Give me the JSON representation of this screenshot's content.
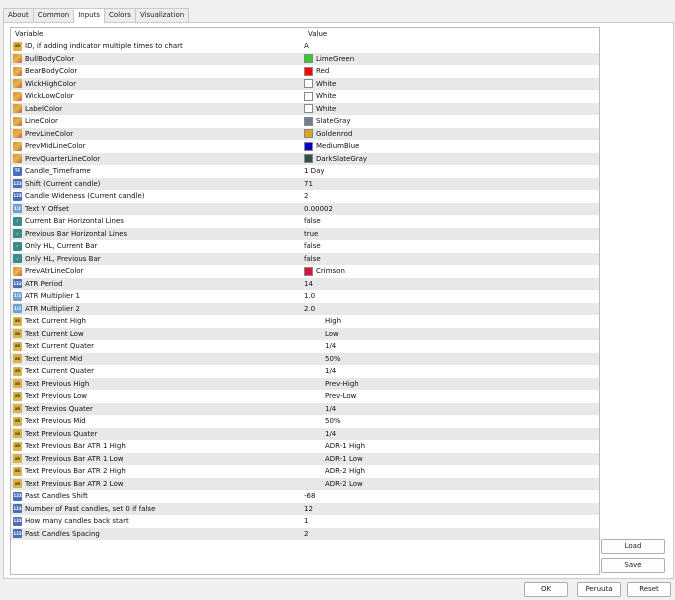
{
  "tabs": [
    "About",
    "Common",
    "Inputs",
    "Colors",
    "Visualization"
  ],
  "columns": {
    "variable": "Variable",
    "value": "Value"
  },
  "rows": [
    {
      "icon": "string",
      "name": "ID, if adding indicator multiple times to chart",
      "value": "A"
    },
    {
      "icon": "color",
      "name": "BullBodyColor",
      "value": "LimeGreen",
      "color": "#32cd32"
    },
    {
      "icon": "color",
      "name": "BearBodyColor",
      "value": "Red",
      "color": "#ff0000"
    },
    {
      "icon": "color",
      "name": "WickHighColor",
      "value": "White",
      "color": "#ffffff"
    },
    {
      "icon": "color",
      "name": "WickLowColor",
      "value": "White",
      "color": "#ffffff"
    },
    {
      "icon": "color",
      "name": "LabelColor",
      "value": "White",
      "color": "#ffffff"
    },
    {
      "icon": "color",
      "name": "LineColor",
      "value": "SlateGray",
      "color": "#708090"
    },
    {
      "icon": "color",
      "name": "PrevLineColor",
      "value": "Goldenrod",
      "color": "#daa520"
    },
    {
      "icon": "color",
      "name": "PrevMidLineColor",
      "value": "MediumBlue",
      "color": "#0000cd"
    },
    {
      "icon": "color",
      "name": "PrevQuarterLineColor",
      "value": "DarkSlateGray",
      "color": "#2f4f4f"
    },
    {
      "icon": "timeframe",
      "name": "Candle_Timeframe",
      "value": "1 Day"
    },
    {
      "icon": "int",
      "name": "Shift (Current candle)",
      "value": "71"
    },
    {
      "icon": "int",
      "name": "Candle Wideness (Current candle)",
      "value": "2"
    },
    {
      "icon": "double",
      "name": "Text Y Offset",
      "value": "0.00002"
    },
    {
      "icon": "bool",
      "name": "Current Bar Horizontal Lines",
      "value": "false"
    },
    {
      "icon": "bool",
      "name": "Previous Bar Horizontal Lines",
      "value": "true"
    },
    {
      "icon": "bool",
      "name": "Only HL, Current Bar",
      "value": "false"
    },
    {
      "icon": "bool",
      "name": "Only HL, Previous Bar",
      "value": "false"
    },
    {
      "icon": "color",
      "name": "PrevAtrLineColor",
      "value": "Crimson",
      "color": "#dc143c"
    },
    {
      "icon": "int",
      "name": "ATR Period",
      "value": "14"
    },
    {
      "icon": "double",
      "name": "ATR Multiplier 1",
      "value": "1.0"
    },
    {
      "icon": "double",
      "name": "ATR Multiplier 2",
      "value": "2.0"
    },
    {
      "icon": "string",
      "name": "Text Current High",
      "value": "High",
      "indent": true
    },
    {
      "icon": "string",
      "name": "Text Current Low",
      "value": "Low",
      "indent": true
    },
    {
      "icon": "string",
      "name": "Text Current Quater",
      "value": "1/4",
      "indent": true
    },
    {
      "icon": "string",
      "name": "Text Current Mid",
      "value": "50%",
      "indent": true
    },
    {
      "icon": "string",
      "name": "Text Current Quater",
      "value": "1/4",
      "indent": true
    },
    {
      "icon": "string",
      "name": "Text Previous High",
      "value": "Prev-High",
      "indent": true
    },
    {
      "icon": "string",
      "name": "Text Previous Low",
      "value": "Prev-Low",
      "indent": true
    },
    {
      "icon": "string",
      "name": "Text Previos Quater",
      "value": "1/4",
      "indent": true
    },
    {
      "icon": "string",
      "name": "Text Previous Mid",
      "value": "50%",
      "indent": true
    },
    {
      "icon": "string",
      "name": "Text Previous Quater",
      "value": "1/4",
      "indent": true
    },
    {
      "icon": "string",
      "name": "Text Previous Bar ATR 1 High",
      "value": "ADR-1 High",
      "indent": true
    },
    {
      "icon": "string",
      "name": "Text Previous Bar ATR 1 Low",
      "value": "ADR-1 Low",
      "indent": true
    },
    {
      "icon": "string",
      "name": "Text Previous Bar ATR 2 High",
      "value": "ADR-2 High",
      "indent": true
    },
    {
      "icon": "string",
      "name": "Text Previous Bar ATR 2 Low",
      "value": "ADR-2 Low",
      "indent": true
    },
    {
      "icon": "int",
      "name": "Past Candles Shift",
      "value": "-68"
    },
    {
      "icon": "int",
      "name": "Number of Past candles, set 0 if false",
      "value": "12"
    },
    {
      "icon": "int",
      "name": "How many candles back start",
      "value": "1"
    },
    {
      "icon": "int",
      "name": "Past Candles Spacing",
      "value": "2"
    }
  ],
  "side_buttons": {
    "load": "Load",
    "save": "Save"
  },
  "footer_buttons": {
    "ok": "OK",
    "cancel": "Peruuta",
    "reset": "Reset"
  }
}
